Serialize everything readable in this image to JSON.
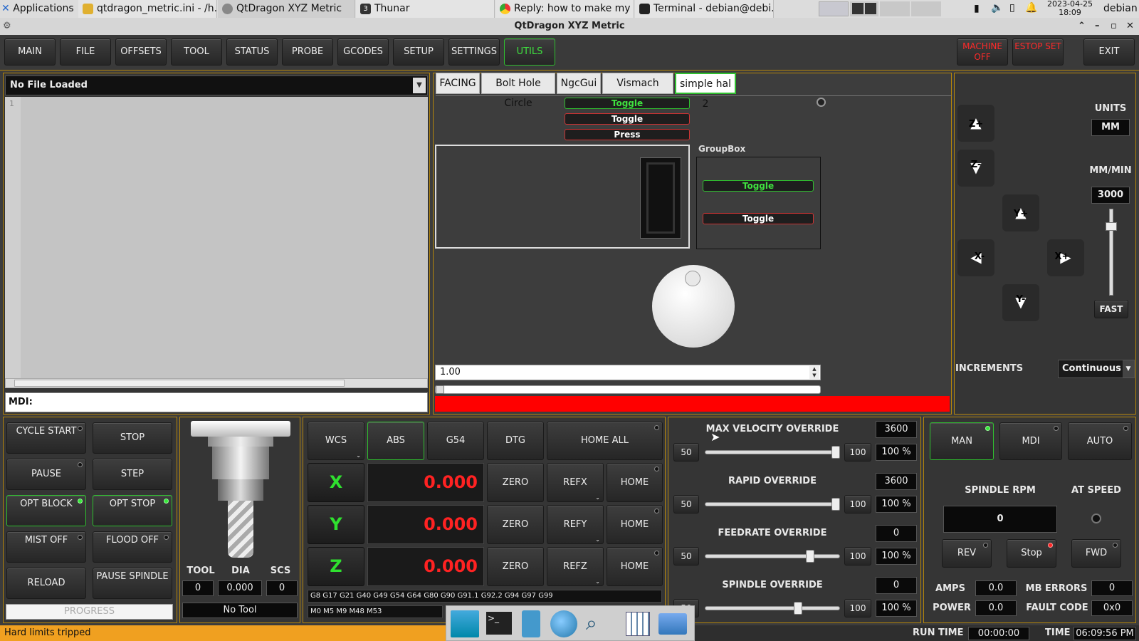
{
  "taskbar": {
    "apps": "Applications",
    "tasks": [
      "qtdragon_metric.ini - /h...",
      "QtDragon XYZ Metric",
      "Thunar",
      "Reply: how to make my ...",
      "Terminal - debian@debi..."
    ],
    "thunar_badge": "3",
    "date": "2023-04-25",
    "time": "18:09",
    "user": "debian"
  },
  "window": {
    "title": "QtDragon XYZ Metric"
  },
  "nav": {
    "tabs": [
      "MAIN",
      "FILE",
      "OFFSETS",
      "TOOL",
      "STATUS",
      "PROBE",
      "GCODES",
      "SETUP",
      "SETTINGS",
      "UTILS"
    ],
    "active": "UTILS",
    "machine_off": "MACHINE OFF",
    "estop": "ESTOP SET",
    "exit": "EXIT"
  },
  "editor": {
    "file": "No File Loaded",
    "line_no": "1",
    "mdi_label": "MDI:"
  },
  "utils": {
    "tabs": [
      "FACING",
      "Bolt Hole Circle",
      "NgcGui",
      "Vismach demo",
      "simple hal 2"
    ],
    "active": "simple hal 2",
    "toggle1": "Toggle",
    "toggle2": "Toggle",
    "press": "Press",
    "groupbox": "GroupBox",
    "gb_toggle1": "Toggle",
    "gb_toggle2": "Toggle",
    "spin_value": "1.00",
    "progress_fraction": 0.0
  },
  "jog": {
    "units_label": "UNITS",
    "units": "MM",
    "rate_label": "MM/MIN",
    "rate": "3000",
    "fast": "FAST",
    "increments_label": "INCREMENTS",
    "increments": "Continuous",
    "zplus": "Z+",
    "zminus": "Z-",
    "yplus": "Y+",
    "yminus": "Y-",
    "xplus": "X+",
    "xminus": "X-"
  },
  "controls": {
    "cycle_start": "CYCLE START",
    "stop": "STOP",
    "pause": "PAUSE",
    "step": "STEP",
    "opt_block": "OPT BLOCK",
    "opt_stop": "OPT STOP",
    "mist": "MIST OFF",
    "flood": "FLOOD OFF",
    "reload": "RELOAD",
    "pause_spindle": "PAUSE SPINDLE",
    "progress": "PROGRESS"
  },
  "tool": {
    "tool_label": "TOOL",
    "dia_label": "DIA",
    "scs_label": "SCS",
    "tool": "0",
    "dia": "0.000",
    "scs": "0",
    "name": "No Tool"
  },
  "dro": {
    "wcs": "WCS",
    "abs": "ABS",
    "g54": "G54",
    "dtg": "DTG",
    "home_all": "HOME ALL",
    "axes": [
      {
        "axis": "X",
        "value": "0.000",
        "ref": "REFX"
      },
      {
        "axis": "Y",
        "value": "0.000",
        "ref": "REFY"
      },
      {
        "axis": "Z",
        "value": "0.000",
        "ref": "REFZ"
      }
    ],
    "zero": "ZERO",
    "home": "HOME",
    "gcodes": "G8 G17 G21 G40 G49 G54 G64 G80 G90 G91.1 G92.2 G94 G97 G99",
    "mcodes": "M0 M5 M9 M48 M53"
  },
  "overrides": [
    {
      "label": "MAX VELOCITY OVERRIDE",
      "value": "3600",
      "pct": "100 %",
      "level": 1.0
    },
    {
      "label": "RAPID OVERRIDE",
      "value": "3600",
      "pct": "100 %",
      "level": 1.0
    },
    {
      "label": "FEEDRATE OVERRIDE",
      "value": "0",
      "pct": "100 %",
      "level": 0.8
    },
    {
      "label": "SPINDLE OVERRIDE",
      "value": "0",
      "pct": "100 %",
      "level": 0.7
    }
  ],
  "ov_min": "50",
  "ov_max": "100",
  "spindle": {
    "man": "MAN",
    "mdi": "MDI",
    "auto": "AUTO",
    "rpm_label": "SPINDLE RPM",
    "at_speed": "AT SPEED",
    "rpm": "0",
    "rev": "REV",
    "stop": "Stop",
    "fwd": "FWD",
    "amps_label": "AMPS",
    "amps": "0.0",
    "mb_label": "MB ERRORS",
    "mb": "0",
    "power_label": "POWER",
    "power": "0.0",
    "fault_label": "FAULT CODE",
    "fault": "0x0"
  },
  "status": {
    "message": "Hard limits tripped",
    "run_time_label": "RUN TIME",
    "run_time": "00:00:00",
    "time_label": "TIME",
    "time": "06:09:56 PM"
  },
  "colors": {
    "accent": "#b5860b",
    "green": "#2fe02f",
    "red": "#ff2222",
    "status_bar": "#f0a020"
  }
}
